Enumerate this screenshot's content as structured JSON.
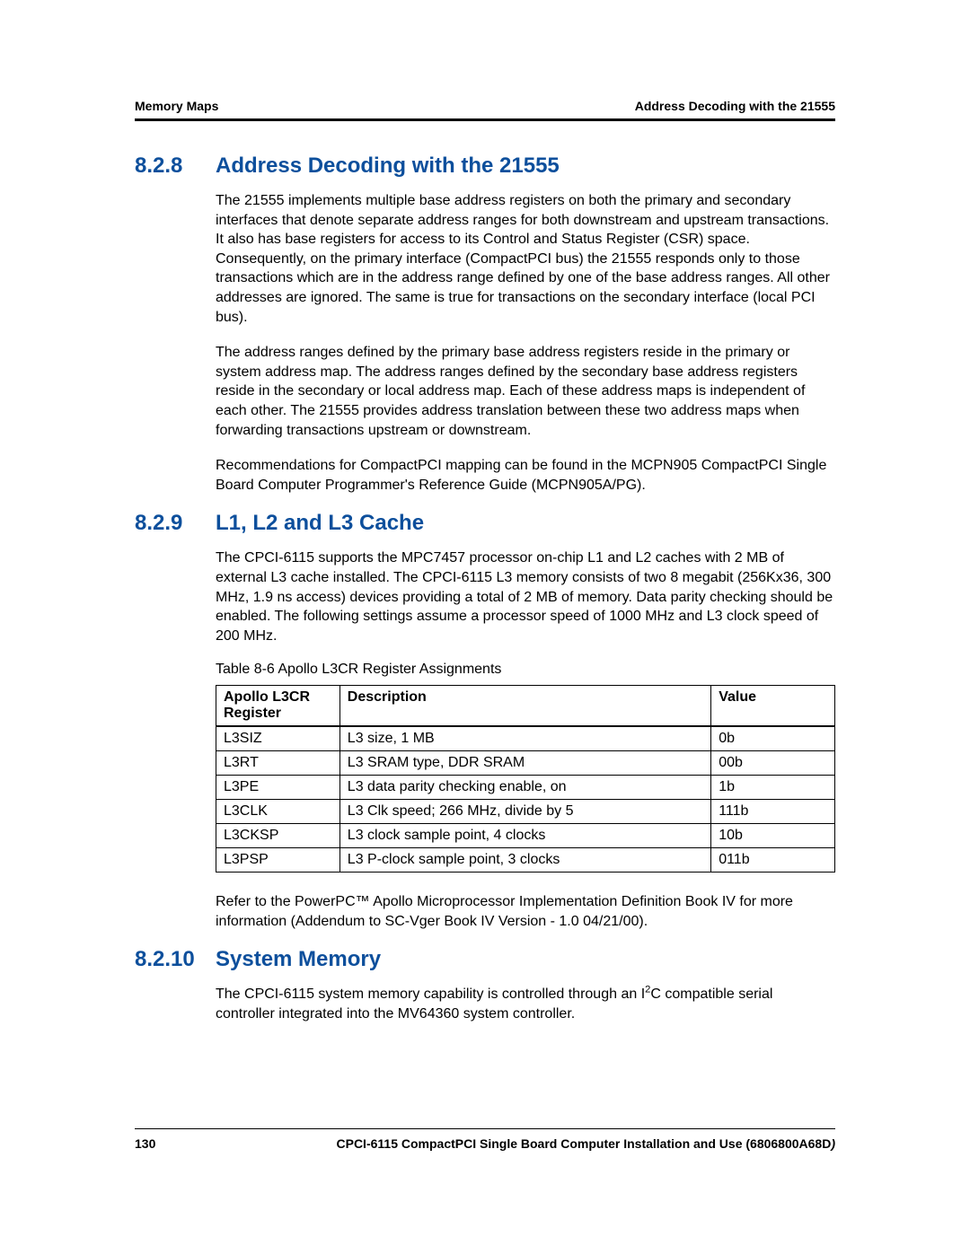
{
  "header": {
    "left": "Memory Maps",
    "right": "Address Decoding with the 21555"
  },
  "sections": [
    {
      "number": "8.2.8",
      "title": "Address Decoding with the 21555",
      "paragraphs": [
        "The 21555 implements multiple base address registers on both the primary and secondary interfaces that denote separate address ranges for both downstream and upstream transactions. It also has base registers for access to its Control and Status Register (CSR) space. Consequently, on the primary interface (CompactPCI bus) the 21555 responds only to those transactions which are in the address range defined by one of the base address ranges. All other addresses are ignored. The same is true for transactions on the secondary interface (local PCI bus).",
        "The address ranges defined by the primary base address registers reside in the primary or system address map. The address ranges defined by the secondary base address registers reside in the secondary or local address map. Each of these address maps is independent of each other. The 21555 provides address translation between these two address maps when forwarding transactions upstream or downstream.",
        "Recommendations for CompactPCI mapping can be found in the MCPN905 CompactPCI Single Board Computer Programmer's Reference Guide (MCPN905A/PG)."
      ]
    },
    {
      "number": "8.2.9",
      "title": "L1, L2 and L3 Cache",
      "paragraphs": [
        "The CPCI-6115 supports the MPC7457 processor on-chip L1 and L2 caches with 2 MB of external L3 cache installed. The CPCI-6115 L3 memory consists of two 8 megabit (256Kx36, 300 MHz, 1.9 ns access) devices providing a total of 2 MB of memory. Data parity checking should be enabled. The following settings assume a processor speed of 1000 MHz and L3 clock speed of 200 MHz."
      ],
      "table_caption": "Table 8-6 Apollo L3CR Register Assignments",
      "table": {
        "headers": [
          "Apollo L3CR Register",
          "Description",
          "Value"
        ],
        "rows": [
          [
            "L3SIZ",
            "L3 size, 1 MB",
            "0b"
          ],
          [
            "L3RT",
            "L3 SRAM type, DDR SRAM",
            "00b"
          ],
          [
            "L3PE",
            "L3 data parity checking enable, on",
            "1b"
          ],
          [
            "L3CLK",
            "L3 Clk speed; 266 MHz, divide by 5",
            "111b"
          ],
          [
            "L3CKSP",
            "L3 clock sample point, 4 clocks",
            "10b"
          ],
          [
            "L3PSP",
            "L3 P-clock sample point, 3 clocks",
            "011b"
          ]
        ]
      },
      "after_table": "Refer to the PowerPC™ Apollo Microprocessor Implementation Definition Book IV for more information (Addendum to SC-Vger Book IV Version - 1.0 04/21/00)."
    },
    {
      "number": "8.2.10",
      "title": "System Memory",
      "paragraphs_html": [
        "The CPCI-6115 system memory capability is controlled through an I<span class=\"sup\">2</span>C compatible serial controller integrated into the MV64360 system controller."
      ]
    }
  ],
  "footer": {
    "page_number": "130",
    "doc_title": "CPCI-6115 CompactPCI Single Board Computer Installation and Use (6806800A68D",
    "doc_title_close": ")"
  }
}
